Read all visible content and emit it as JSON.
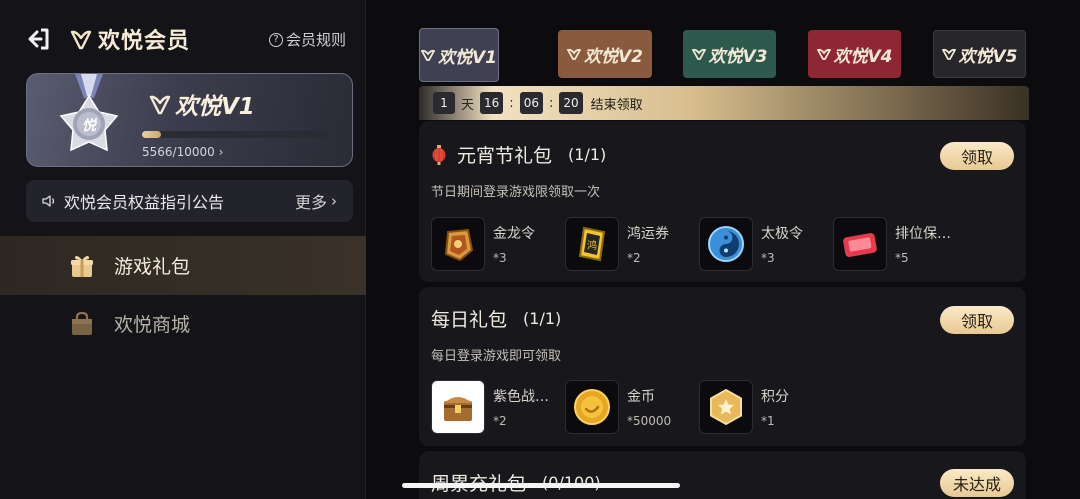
{
  "header": {
    "title": "欢悦会员",
    "rules_label": "会员规则"
  },
  "member": {
    "level_name": "欢悦V1",
    "progress_text": "5566/10000",
    "progress_fraction": 0.1,
    "badge_text": "悦"
  },
  "notice": {
    "text": "欢悦会员权益指引公告",
    "more_label": "更多"
  },
  "sidebar": {
    "items": [
      {
        "label": "游戏礼包",
        "active": true
      },
      {
        "label": "欢悦商城",
        "active": false
      }
    ]
  },
  "tabs": [
    {
      "label": "欢悦V1",
      "color": "#3f4152",
      "active": true
    },
    {
      "label": "欢悦V2",
      "color": "#8a5a3e",
      "active": false
    },
    {
      "label": "欢悦V3",
      "color": "#2e5a4e",
      "active": false
    },
    {
      "label": "欢悦V4",
      "color": "#8e2633",
      "active": false
    },
    {
      "label": "欢悦V5",
      "color": "#26262b",
      "active": false
    }
  ],
  "timer": {
    "days": "1",
    "day_unit": "天",
    "hours": "16",
    "minutes": "06",
    "seconds": "20",
    "sep": ":",
    "suffix": "结束领取"
  },
  "packs": [
    {
      "title": "元宵节礼包",
      "count": "(1/1)",
      "desc": "节日期间登录游戏限领取一次",
      "button": "领取",
      "rewards": [
        {
          "name": "金龙令",
          "qty": "*3",
          "icon": "golden-dragon-token-icon"
        },
        {
          "name": "鸿运券",
          "qty": "*2",
          "icon": "fortune-ticket-icon"
        },
        {
          "name": "太极令",
          "qty": "*3",
          "icon": "taiji-token-icon"
        },
        {
          "name": "排位保…",
          "qty": "*5",
          "icon": "rank-protection-card-icon"
        }
      ]
    },
    {
      "title": "每日礼包",
      "count": "(1/1)",
      "desc": "每日登录游戏即可领取",
      "button": "领取",
      "rewards": [
        {
          "name": "紫色战…",
          "qty": "*2",
          "icon": "purple-chest-icon"
        },
        {
          "name": "金币",
          "qty": "*50000",
          "icon": "gold-coin-icon"
        },
        {
          "name": "积分",
          "qty": "*1",
          "icon": "points-icon"
        }
      ]
    },
    {
      "title": "周累充礼包",
      "count": "(0/100)",
      "button": "未达成"
    }
  ]
}
